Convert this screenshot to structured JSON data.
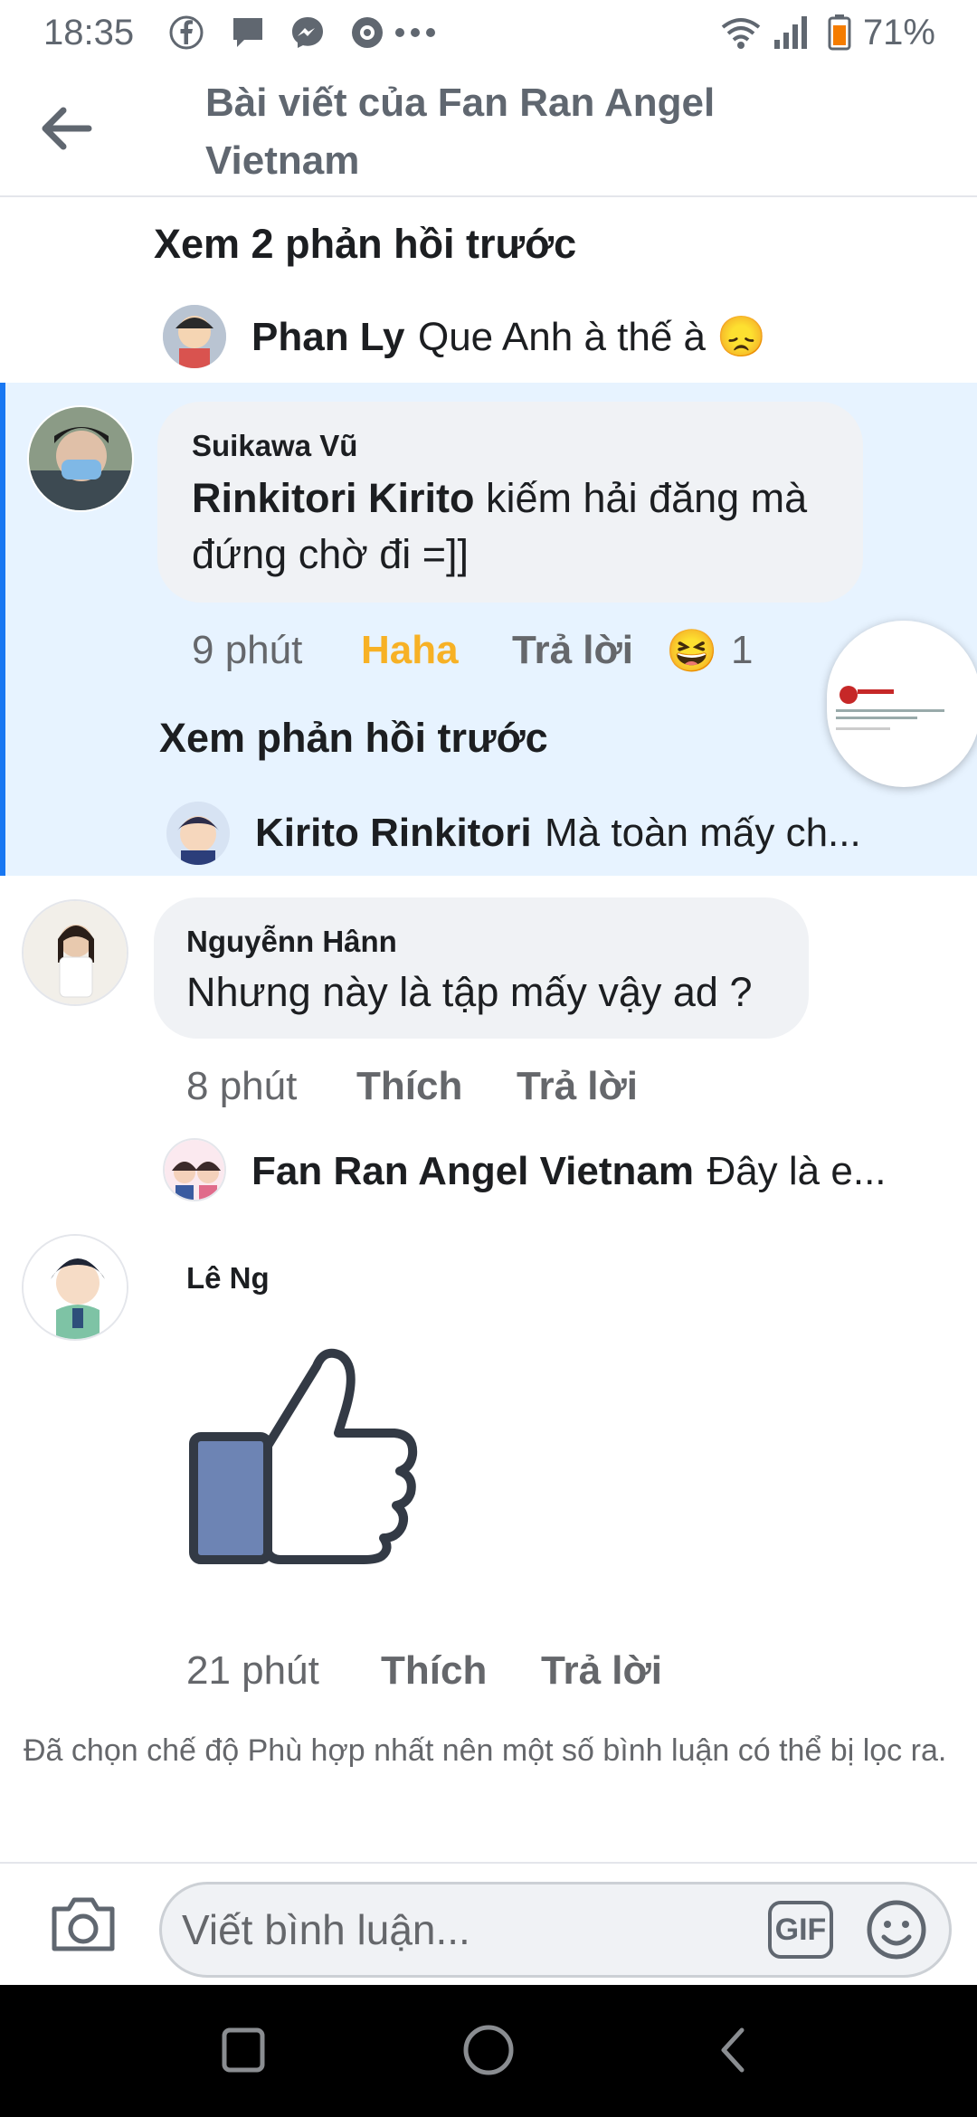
{
  "status_bar": {
    "time": "18:35",
    "battery": "71%",
    "icons": [
      "facebook-icon",
      "message-icon",
      "messenger-icon",
      "settings-icon",
      "more-dots-icon",
      "wifi-icon",
      "signal-icon",
      "battery-icon"
    ]
  },
  "header": {
    "title_line1": "Bài viết của Fan Ran Angel",
    "title_line2": "Vietnam"
  },
  "thread1": {
    "view_prev": "Xem 2 phản hồi trước",
    "reply": {
      "name": "Phan Ly",
      "text": "Que Anh à thế à 😞"
    }
  },
  "comment_highlight": {
    "author": "Suikawa Vũ",
    "mention": "Rinkitori Kirito",
    "text_line1_rest": " kiếm hải đăng mà",
    "text_line2": "đứng chờ đi =]]",
    "time": "9 phút",
    "reaction_label": "Haha",
    "reply_label": "Trả lời",
    "reaction_emoji": "😆",
    "reaction_count": "1",
    "view_prev": "Xem phản hồi trước",
    "reply": {
      "name": "Kirito Rinkitori",
      "text": "Mà toàn mấy ch..."
    }
  },
  "comment2": {
    "author": "Nguyễnn Hânn",
    "text": "Nhưng này là tập mấy vậy ad ?",
    "time": "8 phút",
    "like_label": "Thích",
    "reply_label": "Trả lời",
    "reply": {
      "name": "Fan Ran Angel Vietnam",
      "text": "Đây là e..."
    }
  },
  "comment3": {
    "author": "Lê Ng",
    "time": "21 phút",
    "like_label": "Thích",
    "reply_label": "Trả lời"
  },
  "filter_note": "Đã chọn chế độ Phù hợp nhất nên một số bình luận có thể bị lọc ra.",
  "composer": {
    "placeholder": "Viết bình luận...",
    "gif_label": "GIF"
  },
  "colors": {
    "accent": "#1877f2",
    "highlight_bg": "#e7f3ff",
    "haha": "#f7b125",
    "bubble_bg": "#f0f2f5"
  }
}
